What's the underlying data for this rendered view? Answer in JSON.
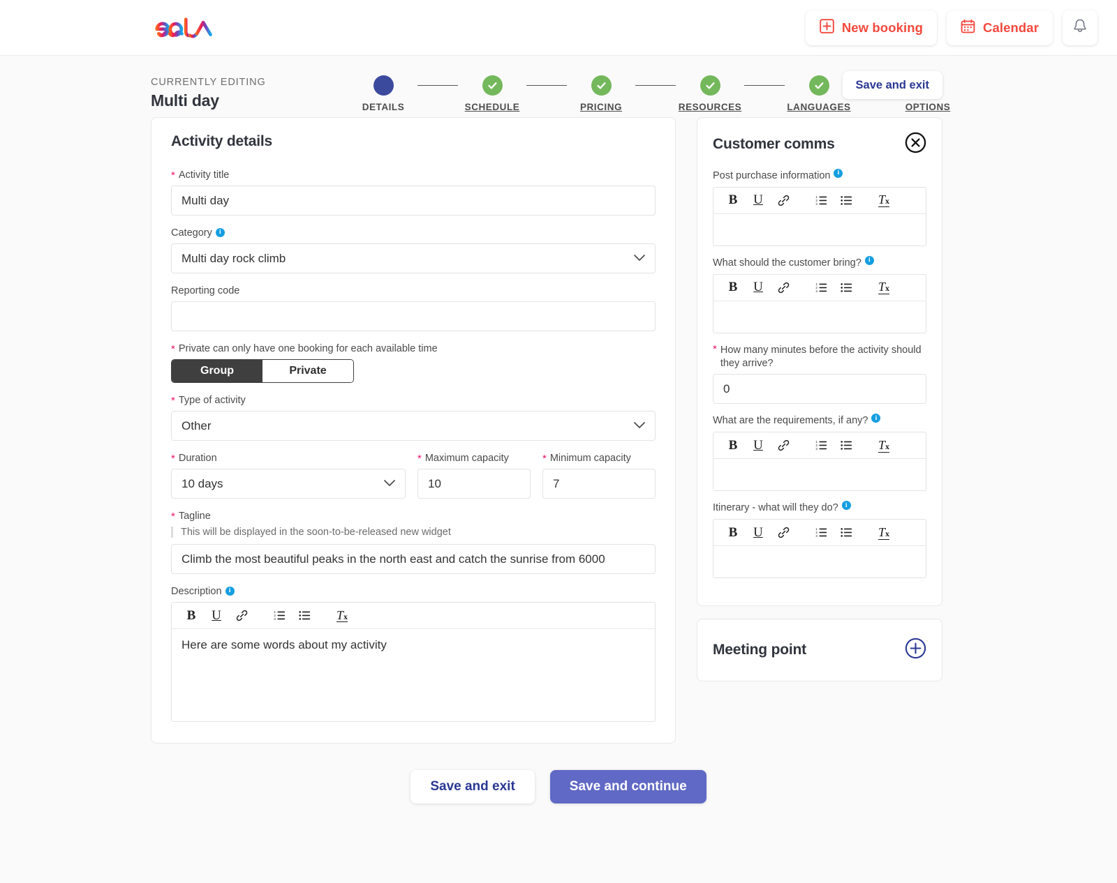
{
  "brand": {
    "logo_text": "eola",
    "logo_colors": [
      "#f7631f",
      "#ee1a5c",
      "#7a3fb8",
      "#16a7e8"
    ]
  },
  "topbar": {
    "new_booking_label": "New booking",
    "calendar_label": "Calendar",
    "notifications_icon": "bell-icon",
    "accent": "#f4483d"
  },
  "editing": {
    "eyebrow": "CURRENTLY EDITING",
    "name": "Multi day",
    "save_and_exit_label": "Save and exit"
  },
  "stepper": {
    "active_color": "#3c4a9e",
    "done_color": "#74b85c",
    "steps": [
      {
        "label": "DETAILS",
        "state": "active"
      },
      {
        "label": "SCHEDULE",
        "state": "done"
      },
      {
        "label": "PRICING",
        "state": "done"
      },
      {
        "label": "RESOURCES",
        "state": "done"
      },
      {
        "label": "LANGUAGES",
        "state": "done"
      },
      {
        "label": "OPTIONS",
        "state": "done"
      }
    ]
  },
  "activity_details": {
    "title": "Activity details",
    "activity_title": {
      "label": "Activity title",
      "required": true,
      "value": "Multi day",
      "placeholder": ""
    },
    "category": {
      "label": "Category",
      "info": true,
      "value": "Multi day rock climb",
      "options": [
        "Multi day rock climb"
      ]
    },
    "reporting_code": {
      "label": "Reporting code",
      "value": "",
      "placeholder": ""
    },
    "privacy": {
      "label": "Private can only have one booking for each available time",
      "required": true,
      "options": [
        "Group",
        "Private"
      ],
      "selected": "Group"
    },
    "type_of_activity": {
      "label": "Type of activity",
      "required": true,
      "value": "Other",
      "options": [
        "Other"
      ]
    },
    "duration": {
      "label": "Duration",
      "required": true,
      "value": "10 days",
      "options": [
        "10 days"
      ]
    },
    "maximum_capacity": {
      "label": "Maximum capacity",
      "required": true,
      "value": "10"
    },
    "minimum_capacity": {
      "label": "Minimum capacity",
      "required": true,
      "value": "7"
    },
    "tagline": {
      "label": "Tagline",
      "required": true,
      "helper": "This will be displayed in the soon-to-be-released new widget",
      "value": "Climb the most beautiful peaks in the north east and catch the sunrise from 6000"
    },
    "description": {
      "label": "Description",
      "info": true,
      "value": "Here are some words about my activity"
    }
  },
  "rte_toolbar": [
    {
      "name": "bold-icon",
      "glyph": "B"
    },
    {
      "name": "underline-icon",
      "glyph": "U"
    },
    {
      "name": "link-icon",
      "glyph": "link"
    },
    {
      "name": "ordered-list-icon",
      "glyph": "ol"
    },
    {
      "name": "bullet-list-icon",
      "glyph": "ul"
    },
    {
      "name": "clear-formatting-icon",
      "glyph": "Tx"
    }
  ],
  "customer_comms": {
    "title": "Customer comms",
    "close_icon": "close-circle-icon",
    "fields": [
      {
        "label": "Post purchase information",
        "info": true,
        "type": "rte",
        "value": ""
      },
      {
        "label": "What should the customer bring?",
        "info": true,
        "type": "rte",
        "value": ""
      },
      {
        "label": "How many minutes before the activity should they arrive?",
        "required": true,
        "type": "input",
        "value": "0"
      },
      {
        "label": "What are the requirements, if any?",
        "info": true,
        "type": "rte",
        "value": ""
      },
      {
        "label": "Itinerary - what will they do?",
        "info": true,
        "type": "rte",
        "value": ""
      }
    ]
  },
  "meeting_point": {
    "title": "Meeting point",
    "add_icon": "plus-circle-icon",
    "accent": "#2b3894"
  },
  "footer": {
    "save_and_exit_label": "Save and exit",
    "save_and_continue_label": "Save and continue",
    "primary_color": "#6069c5"
  }
}
